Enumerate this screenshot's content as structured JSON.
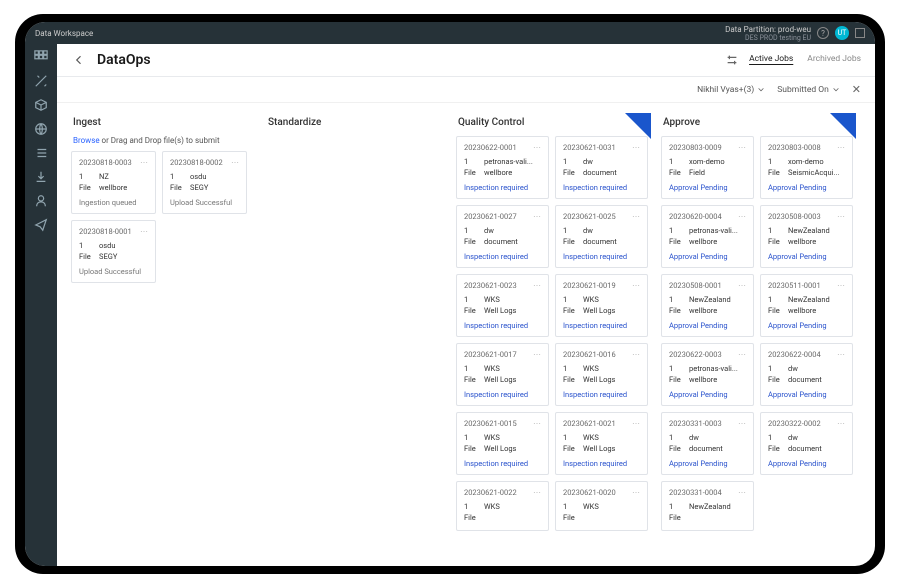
{
  "topbar": {
    "workspace": "Data Workspace",
    "partition": "Data Partition: prod-weu",
    "sub": "DES PROD testing EU",
    "avatar": "UT"
  },
  "header": {
    "title": "DataOps",
    "tabs": {
      "active": "Active Jobs",
      "archived": "Archived Jobs"
    }
  },
  "filters": {
    "user": "Nikhil Vyas+(3)",
    "sort": "Submitted On"
  },
  "cols": {
    "ingest": "Ingest",
    "std": "Standardize",
    "qc": "Quality Control",
    "approve": "Approve"
  },
  "ingest": {
    "browse": "Browse",
    "drop": " or Drag and Drop file(s) to submit",
    "cards": [
      {
        "id": "20230818-0003",
        "cnt": "1",
        "unit": "File",
        "n1": "NZ",
        "n2": "wellbore",
        "status": "Ingestion queued",
        "cls": "st-gray"
      },
      {
        "id": "20230818-0002",
        "cnt": "1",
        "unit": "File",
        "n1": "osdu",
        "n2": "SEGY",
        "status": "Upload Successful",
        "cls": "st-gray"
      },
      {
        "id": "20230818-0001",
        "cnt": "1",
        "unit": "File",
        "n1": "osdu",
        "n2": "SEGY",
        "status": "Upload Successful",
        "cls": "st-gray"
      }
    ]
  },
  "qc": [
    [
      {
        "id": "20230622-0001",
        "cnt": "1",
        "unit": "File",
        "n1": "petronas-vali...",
        "n2": "wellbore",
        "status": "Inspection required"
      },
      {
        "id": "20230621-0031",
        "cnt": "1",
        "unit": "File",
        "n1": "dw",
        "n2": "document",
        "status": "Inspection required"
      }
    ],
    [
      {
        "id": "20230621-0027",
        "cnt": "1",
        "unit": "File",
        "n1": "dw",
        "n2": "document",
        "status": "Inspection required"
      },
      {
        "id": "20230621-0025",
        "cnt": "1",
        "unit": "File",
        "n1": "dw",
        "n2": "document",
        "status": "Inspection required"
      }
    ],
    [
      {
        "id": "20230621-0023",
        "cnt": "1",
        "unit": "File",
        "n1": "WKS",
        "n2": "Well Logs",
        "status": "Inspection required"
      },
      {
        "id": "20230621-0019",
        "cnt": "1",
        "unit": "File",
        "n1": "WKS",
        "n2": "Well Logs",
        "status": "Inspection required"
      }
    ],
    [
      {
        "id": "20230621-0017",
        "cnt": "1",
        "unit": "File",
        "n1": "WKS",
        "n2": "Well Logs",
        "status": "Inspection required"
      },
      {
        "id": "20230621-0016",
        "cnt": "1",
        "unit": "File",
        "n1": "WKS",
        "n2": "Well Logs",
        "status": "Inspection required"
      }
    ],
    [
      {
        "id": "20230621-0015",
        "cnt": "1",
        "unit": "File",
        "n1": "WKS",
        "n2": "Well Logs",
        "status": "Inspection required"
      },
      {
        "id": "20230621-0021",
        "cnt": "1",
        "unit": "File",
        "n1": "WKS",
        "n2": "Well Logs",
        "status": "Inspection required"
      }
    ],
    [
      {
        "id": "20230621-0022",
        "cnt": "1",
        "unit": "File",
        "n1": "WKS",
        "n2": "",
        "status": ""
      },
      {
        "id": "20230621-0020",
        "cnt": "1",
        "unit": "File",
        "n1": "WKS",
        "n2": "",
        "status": ""
      }
    ]
  ],
  "approve": [
    [
      {
        "id": "20230803-0009",
        "cnt": "1",
        "unit": "File",
        "n1": "xom-demo",
        "n2": "Field",
        "status": "Approval Pending"
      },
      {
        "id": "20230803-0008",
        "cnt": "1",
        "unit": "File",
        "n1": "xom-demo",
        "n2": "SeismicAcqui...",
        "status": "Approval Pending"
      }
    ],
    [
      {
        "id": "20230620-0004",
        "cnt": "1",
        "unit": "File",
        "n1": "petronas-vali...",
        "n2": "wellbore",
        "status": "Approval Pending"
      },
      {
        "id": "20230508-0003",
        "cnt": "1",
        "unit": "File",
        "n1": "NewZealand",
        "n2": "wellbore",
        "status": "Approval Pending"
      }
    ],
    [
      {
        "id": "20230508-0001",
        "cnt": "1",
        "unit": "File",
        "n1": "NewZealand",
        "n2": "wellbore",
        "status": "Approval Pending"
      },
      {
        "id": "20230511-0001",
        "cnt": "1",
        "unit": "File",
        "n1": "NewZealand",
        "n2": "wellbore",
        "status": "Approval Pending"
      }
    ],
    [
      {
        "id": "20230622-0003",
        "cnt": "1",
        "unit": "File",
        "n1": "petronas-vali...",
        "n2": "wellbore",
        "status": "Approval Pending"
      },
      {
        "id": "20230622-0004",
        "cnt": "1",
        "unit": "File",
        "n1": "dw",
        "n2": "document",
        "status": "Approval Pending"
      }
    ],
    [
      {
        "id": "20230331-0003",
        "cnt": "1",
        "unit": "File",
        "n1": "dw",
        "n2": "document",
        "status": "Approval Pending"
      },
      {
        "id": "20230322-0002",
        "cnt": "1",
        "unit": "File",
        "n1": "dw",
        "n2": "document",
        "status": "Approval Pending"
      }
    ],
    [
      {
        "id": "20230331-0004",
        "cnt": "1",
        "unit": "File",
        "n1": "NewZealand",
        "n2": "",
        "status": ""
      }
    ]
  ]
}
